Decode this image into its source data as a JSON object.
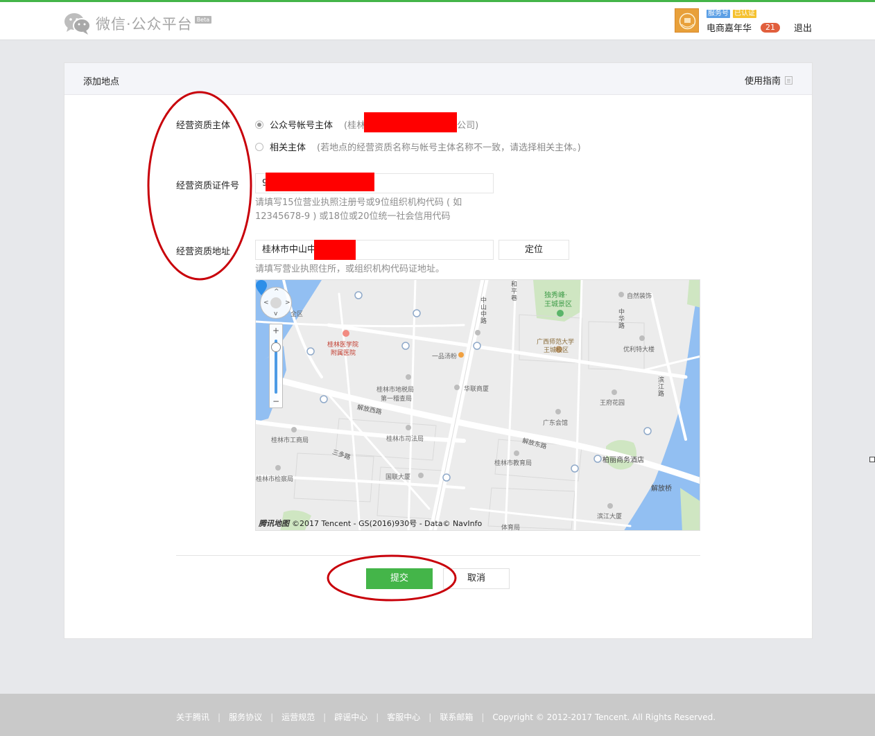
{
  "header": {
    "logo_text": "微信·公众平台",
    "beta": "Beta",
    "account": {
      "service_tag": "服务号",
      "verified_tag": "已认证",
      "name": "电商嘉年华",
      "notification_count": "21",
      "logout": "退出"
    }
  },
  "panel": {
    "title": "添加地点",
    "guide": "使用指南"
  },
  "form": {
    "entity_label": "经营资质主体",
    "entity_option1": "公众号帐号主体",
    "entity_option1_note_prefix": "(桂林",
    "entity_option1_note_suffix": "公司)",
    "entity_option2": "相关主体",
    "entity_option2_note": "(若地点的经营资质名称与帐号主体名称不一致，请选择相关主体。)",
    "license_label": "经营资质证件号",
    "license_value": "9",
    "license_hint_line1": "请填写15位营业执照注册号或9位组织机构代码 ( 如",
    "license_hint_line2": "12345678-9 ) 或18位或20位统一社会信用代码",
    "address_label": "经营资质地址",
    "address_value": "桂林市中山中",
    "locate_button": "定位",
    "address_hint": "请填写营业执照住所，或组织机构代码证地址。"
  },
  "map": {
    "labels": {
      "zhongshan_zhonglu": "中山中路",
      "he_ping_xiang": "和平巷",
      "duxiufeng": "独秀峰·",
      "wangchengjingqu": "王城景区",
      "ziran_zhuangshi": "自然装饰",
      "zhonghua_lu": "中华路",
      "guangxi_normal": "广西师范大学",
      "wangcheng_campus": "王城校区",
      "youli_tedalou": "优利特大楼",
      "yixueyuan": "桂林医学院",
      "fushu_yiyuan": "附属医院",
      "yipin_tangfen": "一品汤粉",
      "dishuiju": "桂林市地税局",
      "dierjicha": "第一稽查局",
      "hualian": "华联商厦",
      "binjiang_lu": "滨江路",
      "wangfu_huayuan": "王府花园",
      "jiefang_xilu": "解放西路",
      "guangdong_huiguan": "广东会馆",
      "gongshang": "桂林市工商局",
      "sifa": "桂林市司法局",
      "jiefang_donglu": "解放东路",
      "boli_hotel": "柏丽商务酒店",
      "sanduo_lu": "三多路",
      "jiaoyu": "桂林市教育局",
      "jiancha": "桂林市检察局",
      "guolian": "国联大厦",
      "jiefang_qiao": "解放桥",
      "binjiang_dasha": "滨江大厦",
      "tiyuju": "体育局",
      "quan": "全区"
    },
    "logo": "腾讯地图",
    "copyright": "©2017 Tencent - GS(2016)930号 - Data© NavInfo"
  },
  "actions": {
    "submit": "提交",
    "cancel": "取消"
  },
  "footer": {
    "links": [
      "关于腾讯",
      "服务协议",
      "运营规范",
      "辟谣中心",
      "客服中心",
      "联系邮箱"
    ],
    "separator": "|",
    "copyright": "Copyright © 2012-2017 Tencent. All Rights Reserved."
  },
  "colors": {
    "brand_green": "#44b549",
    "map_water": "#92bff2",
    "annotation_red": "#c8000a"
  }
}
